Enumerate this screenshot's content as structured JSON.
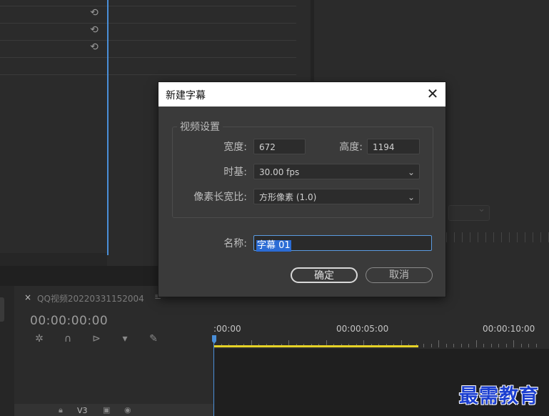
{
  "dialog": {
    "title": "新建字幕",
    "close_glyph": "✕",
    "group_label": "视频设置",
    "width_label": "宽度:",
    "width_value": "672",
    "height_label": "高度:",
    "height_value": "1194",
    "timebase_label": "时基:",
    "timebase_value": "30.00 fps",
    "pixel_aspect_label": "像素长宽比:",
    "pixel_aspect_value": "方形像素 (1.0)",
    "name_label": "名称:",
    "name_value": "字幕 01",
    "ok_label": "确定",
    "cancel_label": "取消"
  },
  "timeline": {
    "sequence_name": "QQ视频20220331152004",
    "close_glyph": "×",
    "menu_glyph": "≡",
    "timecode": "00:00:00:00",
    "ruler_labels": [
      ":00:00",
      "00:00:05:00",
      "00:00:10:00"
    ],
    "track_label": "V3"
  },
  "watermark": "最需教育",
  "icons": {
    "reset": "reset-icon",
    "snap": "snap-icon",
    "magnet": "magnet-icon",
    "insert": "insert-icon",
    "marker": "marker-icon",
    "wrench": "wrench-icon",
    "chevron": "chevron-down-icon"
  },
  "colors": {
    "accent": "#4a8fd8",
    "work_area": "#e6d227",
    "selection": "#2b6cd5",
    "watermark": "#1c3fd0"
  }
}
